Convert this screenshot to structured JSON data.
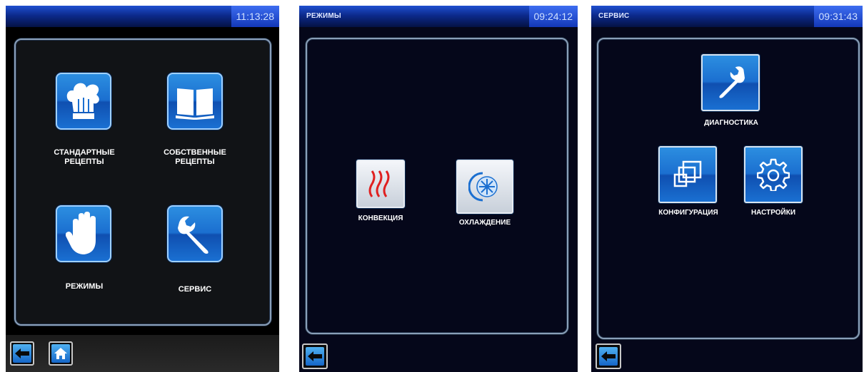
{
  "screen1": {
    "clock": "11:13:28",
    "tiles": [
      {
        "line1": "СТАНДАРТНЫЕ",
        "line2": "РЕЦЕПТЫ",
        "icon": "chef-hat-icon"
      },
      {
        "line1": "СОБСТВЕННЫЕ",
        "line2": "РЕЦЕПТЫ",
        "icon": "book-icon"
      },
      {
        "line1": "РЕЖИМЫ",
        "icon": "hand-icon"
      },
      {
        "line1": "СЕРВИС",
        "icon": "wrench-icon"
      }
    ],
    "nav": [
      "back-arrow-icon",
      "home-icon"
    ]
  },
  "screen2": {
    "title": "РЕЖИМЫ",
    "clock": "09:24:12",
    "tiles": [
      {
        "label": "КОНВЕКЦИЯ",
        "icon": "heat-waves-icon"
      },
      {
        "label": "ОХЛАЖДЕНИЕ",
        "icon": "snowflake-fan-icon"
      }
    ],
    "nav": [
      "back-arrow-icon"
    ]
  },
  "screen3": {
    "title": "СЕРВИС",
    "clock": "09:31:43",
    "tiles": [
      {
        "label": "ДИАГНОСТИКА",
        "icon": "wrench-icon"
      },
      {
        "label": "КОНФИГУРАЦИЯ",
        "icon": "layers-icon"
      },
      {
        "label": "НАСТРОЙКИ",
        "icon": "gear-icon"
      }
    ],
    "nav": [
      "back-arrow-icon"
    ]
  },
  "colors": {
    "accent": "#1b6fd0",
    "topbar": "#0c2a8c",
    "heat": "#e02020"
  }
}
